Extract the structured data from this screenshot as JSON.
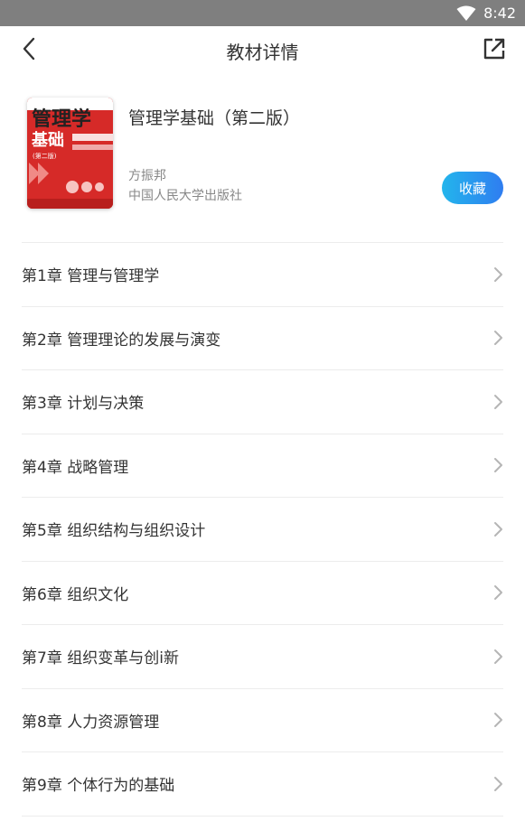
{
  "status_bar": {
    "time": "8:42",
    "wifi_icon": "wifi-icon"
  },
  "nav": {
    "back_icon": "chevron-left-icon",
    "title": "教材详情",
    "share_icon": "share-external-icon"
  },
  "book": {
    "cover_title_line1": "管理学",
    "cover_title_line2": "基础",
    "cover_edition": "(第二版)",
    "title": "管理学基础（第二版）",
    "author": "方振邦",
    "publisher": "中国人民大学出版社",
    "favorite_label": "收藏"
  },
  "colors": {
    "accent_start": "#23b5ec",
    "accent_end": "#2f7df0",
    "cover_red": "#d62a28"
  },
  "chapters": [
    {
      "label": "第1章  管理与管理学"
    },
    {
      "label": "第2章  管理理论的发展与演变"
    },
    {
      "label": "第3章  计划与决策"
    },
    {
      "label": "第4章 战略管理"
    },
    {
      "label": "第5章  组织结构与组织设计"
    },
    {
      "label": "第6章  组织文化"
    },
    {
      "label": "第7章 组织变革与创i新"
    },
    {
      "label": "第8章  人力资源管理"
    },
    {
      "label": "第9章  个体行为的基础"
    }
  ]
}
